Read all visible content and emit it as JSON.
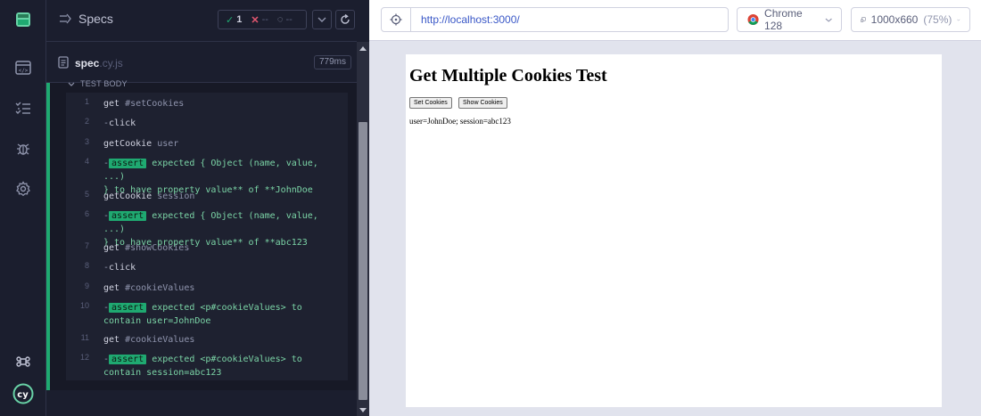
{
  "reporter": {
    "specs_label": "Specs",
    "stats": {
      "passed": "1",
      "failed": "--",
      "pending": "--"
    },
    "spec": {
      "name": "spec",
      "ext": ".cy.js",
      "duration": "779ms"
    },
    "test_body_label": "TEST BODY",
    "commands": [
      {
        "num": "1",
        "name": "get",
        "arg": "#setCookies"
      },
      {
        "num": "2",
        "name": "click",
        "arg": ""
      },
      {
        "num": "3",
        "name": "getCookie",
        "arg": "user"
      },
      {
        "num": "4",
        "badge": "assert",
        "l1": "expected { Object (name, value, ...)",
        "l2": "} to have property value** of **JohnDoe"
      },
      {
        "num": "5",
        "name": "getCookie",
        "arg": "session"
      },
      {
        "num": "6",
        "badge": "assert",
        "l1": "expected { Object (name, value, ...)",
        "l2": "} to have property value** of **abc123"
      },
      {
        "num": "7",
        "name": "get",
        "arg": "#showCookies"
      },
      {
        "num": "8",
        "name": "click",
        "arg": ""
      },
      {
        "num": "9",
        "name": "get",
        "arg": "#cookieValues"
      },
      {
        "num": "10",
        "badge": "assert",
        "l1": "expected <p#cookieValues> to",
        "l2": "contain user=JohnDoe"
      },
      {
        "num": "11",
        "name": "get",
        "arg": "#cookieValues"
      },
      {
        "num": "12",
        "badge": "assert",
        "l1": "expected <p#cookieValues> to",
        "l2": "contain session=abc123"
      }
    ]
  },
  "preview": {
    "url": "http://localhost:3000/",
    "browser": "Chrome 128",
    "viewport": "1000x660",
    "viewport_pct": "(75%)"
  },
  "app": {
    "title": "Get Multiple Cookies Test",
    "set_button": "Set Cookies",
    "show_button": "Show Cookies",
    "values": "user=JohnDoe; session=abc123"
  },
  "colors": {
    "accent_green": "#1fa971",
    "dark_bg": "#1b1e2e",
    "url_blue": "#3a58c7"
  }
}
